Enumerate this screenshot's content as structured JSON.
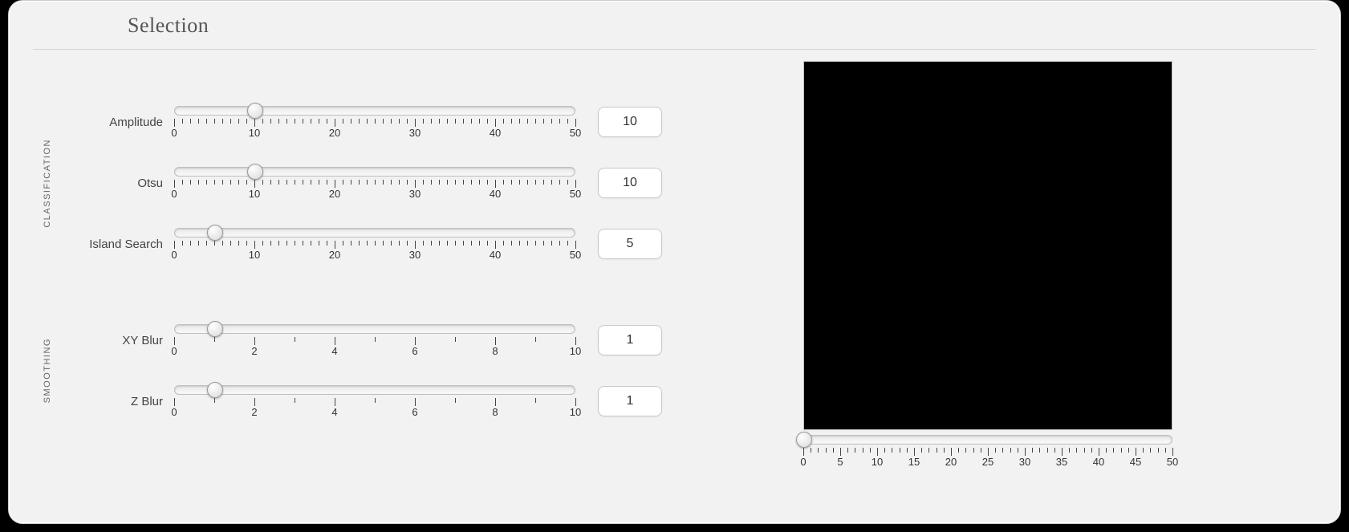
{
  "page_title": "Selection",
  "classification": {
    "group_label": "CLASSIFICATION",
    "sliders": [
      {
        "id": "amplitude",
        "label": "Amplitude",
        "min": 0,
        "max": 50,
        "major_step": 10,
        "minor_div": 10,
        "value": 10
      },
      {
        "id": "otsu",
        "label": "Otsu",
        "min": 0,
        "max": 50,
        "major_step": 10,
        "minor_div": 10,
        "value": 10
      },
      {
        "id": "island-search",
        "label": "Island Search",
        "min": 0,
        "max": 50,
        "major_step": 10,
        "minor_div": 10,
        "value": 5
      }
    ]
  },
  "smoothing": {
    "group_label": "SMOOTHING",
    "sliders": [
      {
        "id": "xy-blur",
        "label": "XY Blur",
        "min": 0,
        "max": 10,
        "major_step": 2,
        "minor_div": 2,
        "value": 1
      },
      {
        "id": "z-blur",
        "label": "Z Blur",
        "min": 0,
        "max": 10,
        "major_step": 2,
        "minor_div": 2,
        "value": 1
      }
    ]
  },
  "preview_slider": {
    "id": "preview-slice",
    "min": 0,
    "max": 50,
    "major_step": 5,
    "minor_div": 5,
    "value": 0
  }
}
